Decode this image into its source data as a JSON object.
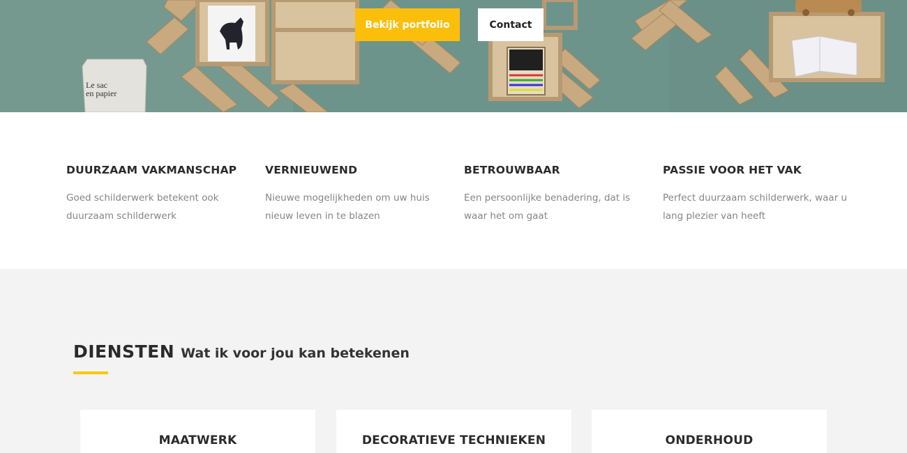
{
  "hero": {
    "primary_button": "Bekijk portfolio",
    "secondary_button": "Contact",
    "bag_text_line1": "Le sac",
    "bag_text_line2": "en papier"
  },
  "features": [
    {
      "title": "DUURZAAM VAKMANSCHAP",
      "text": "Goed schilderwerk betekent ook duurzaam schilderwerk"
    },
    {
      "title": "VERNIEUWEND",
      "text": "Nieuwe mogelijkheden om uw huis nieuw leven in te blazen"
    },
    {
      "title": "BETROUWBAAR",
      "text": "Een persoonlijke benadering, dat is waar het om gaat"
    },
    {
      "title": "PASSIE VOOR HET VAK",
      "text": "Perfect duurzaam schilderwerk, waar u lang plezier van heeft"
    }
  ],
  "services": {
    "title": "DIENSTEN",
    "subtitle": "Wat ik voor jou kan betekenen",
    "cards": [
      {
        "title": "MAATWERK"
      },
      {
        "title": "DECORATIEVE TECHNIEKEN"
      },
      {
        "title": "ONDERHOUD"
      }
    ]
  },
  "colors": {
    "accent": "#fbbf0b",
    "hero_wall": "#6f958c",
    "section_bg": "#f3f3f3"
  }
}
